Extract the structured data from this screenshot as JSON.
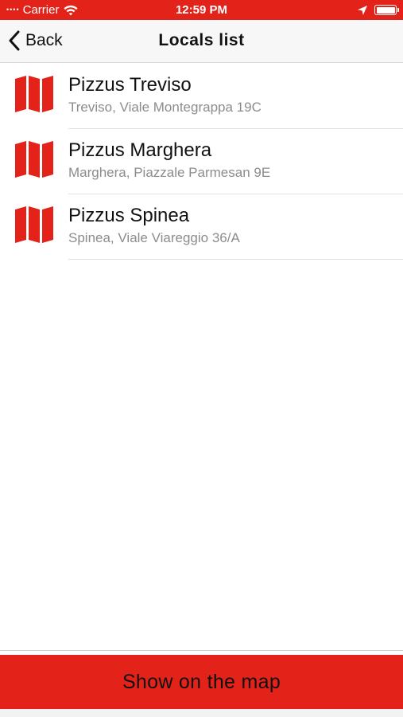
{
  "status_bar": {
    "signal": "••••",
    "carrier": "Carrier",
    "time": "12:59 PM",
    "wifi_icon": "wifi-icon",
    "location_icon": "location-arrow-icon",
    "battery_icon": "battery-icon",
    "battery_level": 1.0
  },
  "nav": {
    "back_label": "Back",
    "back_icon": "chevron-left-icon",
    "title": "Locals list"
  },
  "locals": [
    {
      "name": "Pizzus Treviso",
      "address": "Treviso, Viale Montegrappa 19C",
      "icon": "map-icon"
    },
    {
      "name": "Pizzus Marghera",
      "address": "Marghera, Piazzale Parmesan 9E",
      "icon": "map-icon"
    },
    {
      "name": "Pizzus Spinea",
      "address": "Spinea, Viale Viareggio 36/A",
      "icon": "map-icon"
    }
  ],
  "map_button": {
    "label": "Show on the map"
  },
  "colors": {
    "accent": "#e32219",
    "nav_background": "#f7f7f7",
    "title_text": "#111111",
    "subtitle_text": "#8c8c8c"
  }
}
